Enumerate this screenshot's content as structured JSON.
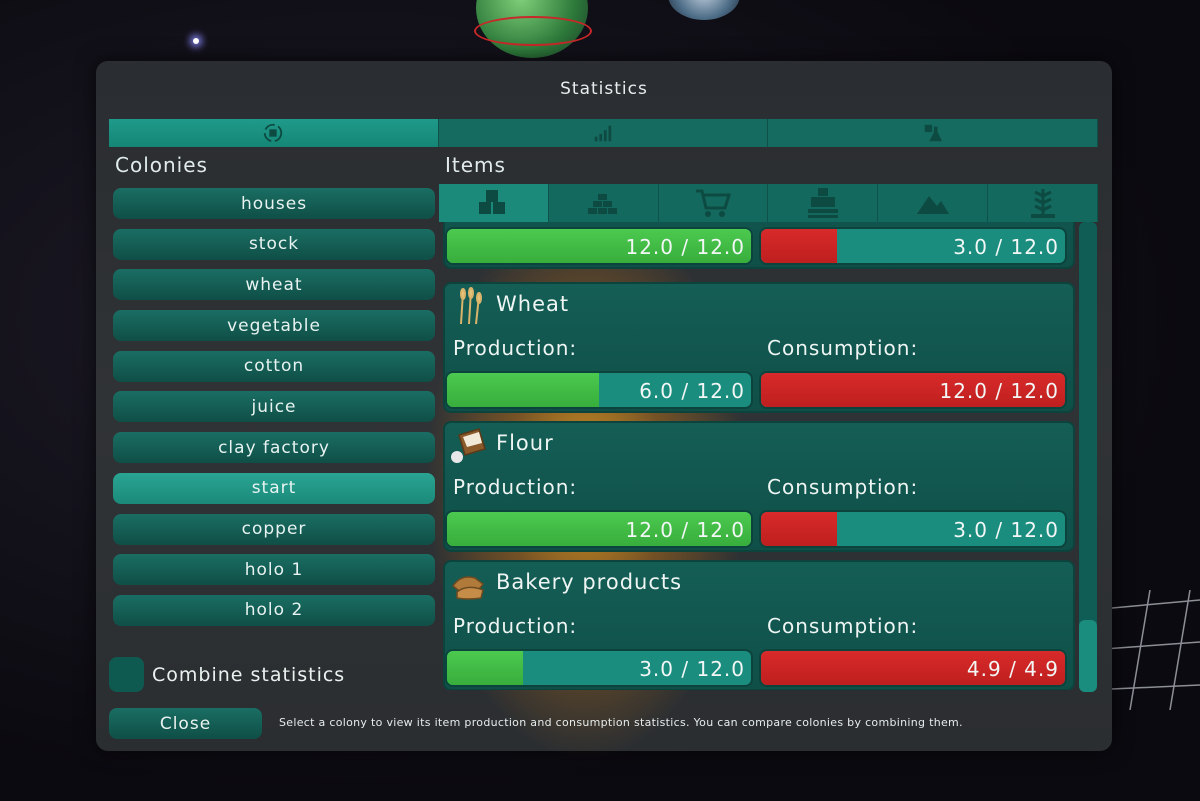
{
  "window": {
    "title": "Statistics"
  },
  "main_tabs": [
    {
      "icon": "colony-cycle-icon",
      "active": true
    },
    {
      "icon": "bar-chart-icon",
      "active": false
    },
    {
      "icon": "research-flask-icon",
      "active": false
    }
  ],
  "colonies": {
    "label": "Colonies",
    "items": [
      {
        "label": "houses",
        "selected": false
      },
      {
        "label": "stock",
        "selected": false
      },
      {
        "label": "wheat",
        "selected": false
      },
      {
        "label": "vegetable",
        "selected": false
      },
      {
        "label": "cotton",
        "selected": false
      },
      {
        "label": "juice",
        "selected": false
      },
      {
        "label": "clay factory",
        "selected": false
      },
      {
        "label": "start",
        "selected": true
      },
      {
        "label": "copper",
        "selected": false
      },
      {
        "label": "holo 1",
        "selected": false
      },
      {
        "label": "holo 2",
        "selected": false
      }
    ]
  },
  "combine": {
    "label": "Combine statistics",
    "checked": false
  },
  "footer": {
    "close_label": "Close",
    "hint": "Select a colony to view its item production and consumption statistics. You can compare colonies by combining them."
  },
  "items": {
    "label": "Items",
    "categories": [
      {
        "icon": "boxes-icon",
        "active": true
      },
      {
        "icon": "bricks-icon",
        "active": false
      },
      {
        "icon": "shopping-cart-icon",
        "active": false
      },
      {
        "icon": "pallet-icon",
        "active": false
      },
      {
        "icon": "mountain-ore-icon",
        "active": false
      },
      {
        "icon": "crop-plant-icon",
        "active": false
      }
    ],
    "production_label": "Production:",
    "consumption_label": "Consumption:",
    "list": [
      {
        "name": "",
        "icon": "",
        "production": {
          "text": "12.0 / 12.0",
          "fraction": 1.0
        },
        "consumption": {
          "text": "3.0 / 12.0",
          "fraction": 0.25
        }
      },
      {
        "name": "Wheat",
        "icon": "wheat-icon",
        "production": {
          "text": "6.0 / 12.0",
          "fraction": 0.5
        },
        "consumption": {
          "text": "12.0 / 12.0",
          "fraction": 1.0
        }
      },
      {
        "name": "Flour",
        "icon": "flour-sack-icon",
        "production": {
          "text": "12.0 / 12.0",
          "fraction": 1.0
        },
        "consumption": {
          "text": "3.0 / 12.0",
          "fraction": 0.25
        }
      },
      {
        "name": "Bakery products",
        "icon": "bread-icon",
        "production": {
          "text": "3.0 / 12.0",
          "fraction": 0.25
        },
        "consumption": {
          "text": "4.9 / 4.9",
          "fraction": 1.0
        }
      }
    ]
  },
  "colors": {
    "production_fill": "#43be46",
    "consumption_fill": "#cc2424",
    "bar_track": "#1a8d7f",
    "panel": "#145e56"
  }
}
